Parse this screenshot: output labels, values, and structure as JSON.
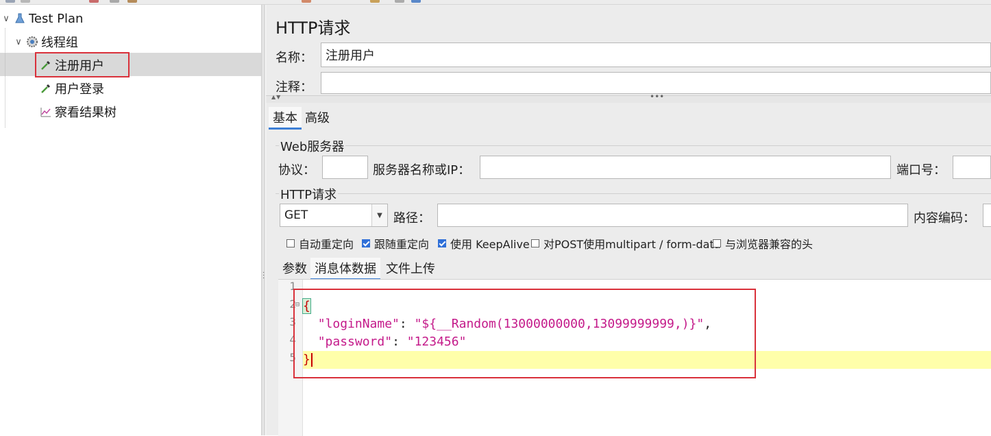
{
  "tree": {
    "items": [
      {
        "label": "Test Plan",
        "icon": "flask-icon",
        "expander": "∨"
      },
      {
        "label": "线程组",
        "icon": "gear-icon",
        "expander": "∨"
      },
      {
        "label": "注册用户",
        "icon": "pipette-icon",
        "selected": true
      },
      {
        "label": "用户登录",
        "icon": "pipette-icon"
      },
      {
        "label": "察看结果树",
        "icon": "chart-icon"
      }
    ]
  },
  "panel": {
    "title": "HTTP请求",
    "name_label": "名称：",
    "name_value": "注册用户",
    "comment_label": "注释：",
    "comment_value": "",
    "tabs": [
      "基本",
      "高级"
    ],
    "web_server": {
      "group_title": "Web服务器",
      "protocol_label": "协议：",
      "protocol_value": "",
      "server_label": "服务器名称或IP：",
      "server_value": "",
      "port_label": "端口号：",
      "port_value": ""
    },
    "http_request": {
      "group_title": "HTTP请求",
      "method": "GET",
      "path_label": "路径：",
      "path_value": "",
      "encoding_label": "内容编码：",
      "encoding_value": ""
    },
    "options": [
      {
        "label": "自动重定向",
        "checked": false
      },
      {
        "label": "跟随重定向",
        "checked": true
      },
      {
        "label": "使用 KeepAlive",
        "checked": true
      },
      {
        "label": "对POST使用multipart / form-data",
        "checked": false
      },
      {
        "label": "与浏览器兼容的头",
        "checked": false
      }
    ],
    "body_tabs": [
      "参数",
      "消息体数据",
      "文件上传"
    ],
    "editor": {
      "line_numbers": [
        "1",
        "2",
        "3",
        "4",
        "5"
      ],
      "fold_marker": "⊟",
      "open_brace": "{",
      "key1": "\"loginName\"",
      "colon": ": ",
      "val1": "\"${__Random(13000000000,13099999999,)}\"",
      "comma": ",",
      "key2": "\"password\"",
      "val2": "\"123456\"",
      "close_brace": "}"
    }
  },
  "colors": {
    "accent": "#3d7fd6",
    "highlight_box": "#d9303a",
    "current_line": "#ffffaa",
    "string": "#c41a8a",
    "brace": "#c80000"
  }
}
